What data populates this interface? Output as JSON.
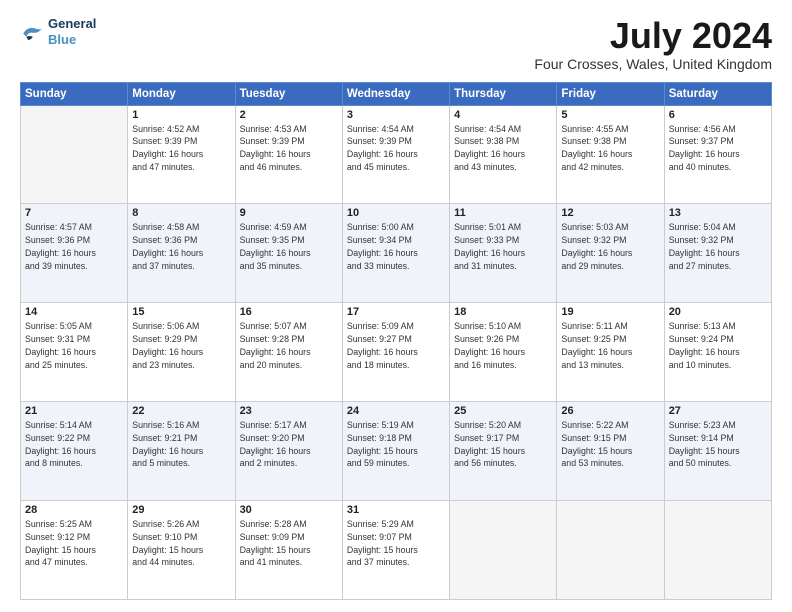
{
  "logo": {
    "line1": "General",
    "line2": "Blue"
  },
  "title": "July 2024",
  "location": "Four Crosses, Wales, United Kingdom",
  "days_of_week": [
    "Sunday",
    "Monday",
    "Tuesday",
    "Wednesday",
    "Thursday",
    "Friday",
    "Saturday"
  ],
  "weeks": [
    [
      {
        "day": "",
        "info": ""
      },
      {
        "day": "1",
        "info": "Sunrise: 4:52 AM\nSunset: 9:39 PM\nDaylight: 16 hours\nand 47 minutes."
      },
      {
        "day": "2",
        "info": "Sunrise: 4:53 AM\nSunset: 9:39 PM\nDaylight: 16 hours\nand 46 minutes."
      },
      {
        "day": "3",
        "info": "Sunrise: 4:54 AM\nSunset: 9:39 PM\nDaylight: 16 hours\nand 45 minutes."
      },
      {
        "day": "4",
        "info": "Sunrise: 4:54 AM\nSunset: 9:38 PM\nDaylight: 16 hours\nand 43 minutes."
      },
      {
        "day": "5",
        "info": "Sunrise: 4:55 AM\nSunset: 9:38 PM\nDaylight: 16 hours\nand 42 minutes."
      },
      {
        "day": "6",
        "info": "Sunrise: 4:56 AM\nSunset: 9:37 PM\nDaylight: 16 hours\nand 40 minutes."
      }
    ],
    [
      {
        "day": "7",
        "info": "Sunrise: 4:57 AM\nSunset: 9:36 PM\nDaylight: 16 hours\nand 39 minutes."
      },
      {
        "day": "8",
        "info": "Sunrise: 4:58 AM\nSunset: 9:36 PM\nDaylight: 16 hours\nand 37 minutes."
      },
      {
        "day": "9",
        "info": "Sunrise: 4:59 AM\nSunset: 9:35 PM\nDaylight: 16 hours\nand 35 minutes."
      },
      {
        "day": "10",
        "info": "Sunrise: 5:00 AM\nSunset: 9:34 PM\nDaylight: 16 hours\nand 33 minutes."
      },
      {
        "day": "11",
        "info": "Sunrise: 5:01 AM\nSunset: 9:33 PM\nDaylight: 16 hours\nand 31 minutes."
      },
      {
        "day": "12",
        "info": "Sunrise: 5:03 AM\nSunset: 9:32 PM\nDaylight: 16 hours\nand 29 minutes."
      },
      {
        "day": "13",
        "info": "Sunrise: 5:04 AM\nSunset: 9:32 PM\nDaylight: 16 hours\nand 27 minutes."
      }
    ],
    [
      {
        "day": "14",
        "info": "Sunrise: 5:05 AM\nSunset: 9:31 PM\nDaylight: 16 hours\nand 25 minutes."
      },
      {
        "day": "15",
        "info": "Sunrise: 5:06 AM\nSunset: 9:29 PM\nDaylight: 16 hours\nand 23 minutes."
      },
      {
        "day": "16",
        "info": "Sunrise: 5:07 AM\nSunset: 9:28 PM\nDaylight: 16 hours\nand 20 minutes."
      },
      {
        "day": "17",
        "info": "Sunrise: 5:09 AM\nSunset: 9:27 PM\nDaylight: 16 hours\nand 18 minutes."
      },
      {
        "day": "18",
        "info": "Sunrise: 5:10 AM\nSunset: 9:26 PM\nDaylight: 16 hours\nand 16 minutes."
      },
      {
        "day": "19",
        "info": "Sunrise: 5:11 AM\nSunset: 9:25 PM\nDaylight: 16 hours\nand 13 minutes."
      },
      {
        "day": "20",
        "info": "Sunrise: 5:13 AM\nSunset: 9:24 PM\nDaylight: 16 hours\nand 10 minutes."
      }
    ],
    [
      {
        "day": "21",
        "info": "Sunrise: 5:14 AM\nSunset: 9:22 PM\nDaylight: 16 hours\nand 8 minutes."
      },
      {
        "day": "22",
        "info": "Sunrise: 5:16 AM\nSunset: 9:21 PM\nDaylight: 16 hours\nand 5 minutes."
      },
      {
        "day": "23",
        "info": "Sunrise: 5:17 AM\nSunset: 9:20 PM\nDaylight: 16 hours\nand 2 minutes."
      },
      {
        "day": "24",
        "info": "Sunrise: 5:19 AM\nSunset: 9:18 PM\nDaylight: 15 hours\nand 59 minutes."
      },
      {
        "day": "25",
        "info": "Sunrise: 5:20 AM\nSunset: 9:17 PM\nDaylight: 15 hours\nand 56 minutes."
      },
      {
        "day": "26",
        "info": "Sunrise: 5:22 AM\nSunset: 9:15 PM\nDaylight: 15 hours\nand 53 minutes."
      },
      {
        "day": "27",
        "info": "Sunrise: 5:23 AM\nSunset: 9:14 PM\nDaylight: 15 hours\nand 50 minutes."
      }
    ],
    [
      {
        "day": "28",
        "info": "Sunrise: 5:25 AM\nSunset: 9:12 PM\nDaylight: 15 hours\nand 47 minutes."
      },
      {
        "day": "29",
        "info": "Sunrise: 5:26 AM\nSunset: 9:10 PM\nDaylight: 15 hours\nand 44 minutes."
      },
      {
        "day": "30",
        "info": "Sunrise: 5:28 AM\nSunset: 9:09 PM\nDaylight: 15 hours\nand 41 minutes."
      },
      {
        "day": "31",
        "info": "Sunrise: 5:29 AM\nSunset: 9:07 PM\nDaylight: 15 hours\nand 37 minutes."
      },
      {
        "day": "",
        "info": ""
      },
      {
        "day": "",
        "info": ""
      },
      {
        "day": "",
        "info": ""
      }
    ]
  ]
}
